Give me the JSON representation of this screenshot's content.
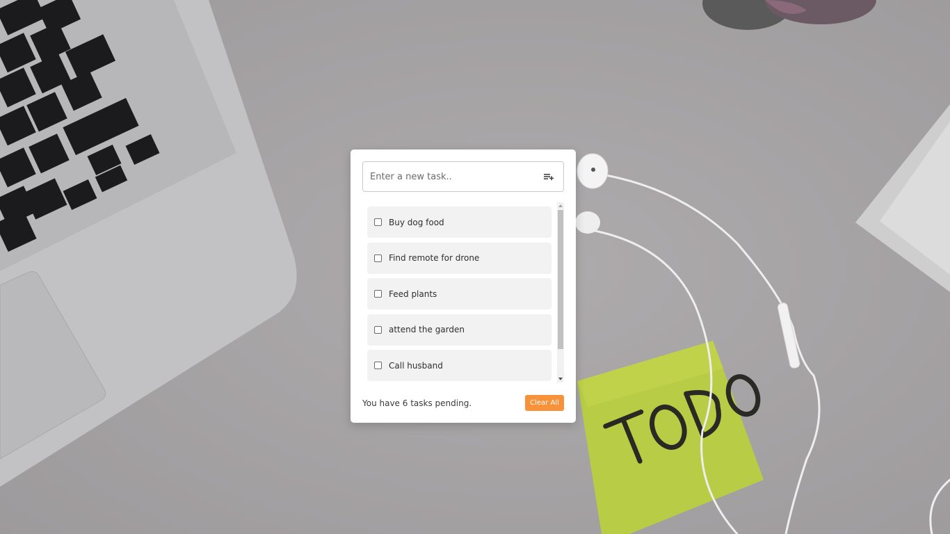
{
  "background": {
    "note_text": "TO DO",
    "note_color": "#b8cd45",
    "desk_color": "#a7a4a6"
  },
  "input": {
    "placeholder": "Enter a new task..",
    "add_icon": "playlist-add-icon"
  },
  "tasks": [
    {
      "label": "Buy dog food",
      "done": false
    },
    {
      "label": "Find remote for drone",
      "done": false
    },
    {
      "label": "Feed plants",
      "done": false
    },
    {
      "label": "attend the garden",
      "done": false
    },
    {
      "label": "Call husband",
      "done": false
    }
  ],
  "footer": {
    "pending_text": "You have 6 tasks pending.",
    "clear_label": "Clear All"
  },
  "colors": {
    "accent": "#f7913a",
    "item_bg": "#f2f2f2"
  }
}
